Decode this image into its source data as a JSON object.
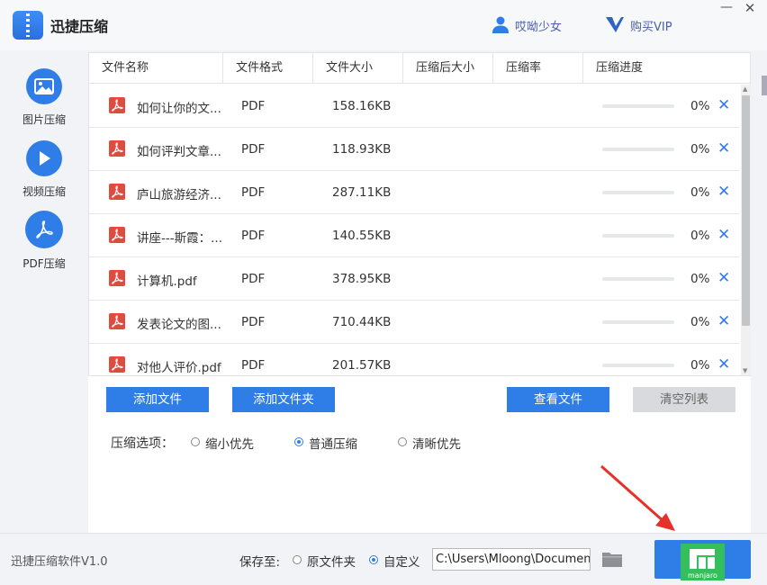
{
  "app": {
    "title": "迅捷压缩",
    "version": "迅捷压缩软件V1.0"
  },
  "header": {
    "user_name": "哎呦少女",
    "vip_label": "购买VIP",
    "minimize": "—",
    "close": "✕"
  },
  "sidebar": {
    "items": [
      {
        "label": "图片压缩",
        "icon": "image-icon"
      },
      {
        "label": "视频压缩",
        "icon": "play-icon"
      },
      {
        "label": "PDF压缩",
        "icon": "pdf-icon"
      }
    ]
  },
  "table": {
    "headers": [
      "文件名称",
      "文件格式",
      "文件大小",
      "压缩后大小",
      "压缩率",
      "压缩进度"
    ],
    "rows": [
      {
        "name": "如何让你的文...",
        "format": "PDF",
        "size": "158.16KB",
        "progress": 0,
        "percent": "0%"
      },
      {
        "name": "如何评判文章...",
        "format": "PDF",
        "size": "118.93KB",
        "progress": 0,
        "percent": "0%"
      },
      {
        "name": "庐山旅游经济...",
        "format": "PDF",
        "size": "287.11KB",
        "progress": 0,
        "percent": "0%"
      },
      {
        "name": "讲座---斯霞：...",
        "format": "PDF",
        "size": "140.55KB",
        "progress": 0,
        "percent": "0%"
      },
      {
        "name": "计算机.pdf",
        "format": "PDF",
        "size": "378.95KB",
        "progress": 0,
        "percent": "0%"
      },
      {
        "name": "发表论文的图...",
        "format": "PDF",
        "size": "710.44KB",
        "progress": 0,
        "percent": "0%"
      },
      {
        "name": "对他人评价.pdf",
        "format": "PDF",
        "size": "201.57KB",
        "progress": 0,
        "percent": "0%"
      }
    ],
    "remove_glyph": "✕"
  },
  "actions": {
    "add_file": "添加文件",
    "add_folder": "添加文件夹",
    "view_files": "查看文件",
    "clear_list": "清空列表"
  },
  "compression": {
    "label": "压缩选项：",
    "options": [
      {
        "label": "缩小优先",
        "checked": false
      },
      {
        "label": "普通压缩",
        "checked": true
      },
      {
        "label": "清晰优先",
        "checked": false
      }
    ]
  },
  "save": {
    "label": "保存至:",
    "options": [
      {
        "label": "原文件夹",
        "checked": false
      },
      {
        "label": "自定义",
        "checked": true
      }
    ],
    "path": "C:\\Users\\Mloong\\Documents"
  },
  "overlay": {
    "logo_text": "manjaro"
  },
  "colors": {
    "accent": "#2f7de6",
    "pdf_red": "#e04b3f",
    "arrow_red": "#e8302a",
    "manjaro_green": "#35bf5c"
  }
}
